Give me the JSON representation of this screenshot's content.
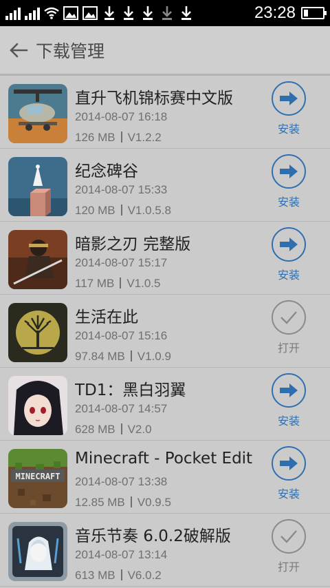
{
  "statusbar": {
    "time": "23:28"
  },
  "header": {
    "title": "下载管理"
  },
  "colors": {
    "accent": "#2f6fb0",
    "muted": "#8a8a8a"
  },
  "apps": [
    {
      "name": "直升飞机锦标赛中文版",
      "date": "2014-08-07 16:18",
      "size": "126 MB",
      "version": "V1.2.2",
      "action": "安装",
      "action_type": "install",
      "icon": "helicopter-icon"
    },
    {
      "name": "纪念碑谷",
      "date": "2014-08-07 15:33",
      "size": "120 MB",
      "version": "V1.0.5.8",
      "action": "安装",
      "action_type": "install",
      "icon": "monument-valley-icon"
    },
    {
      "name": "暗影之刃 完整版",
      "date": "2014-08-07 15:17",
      "size": "117 MB",
      "version": "V1.0.5",
      "action": "安装",
      "action_type": "install",
      "icon": "shadow-blade-icon"
    },
    {
      "name": "生活在此",
      "date": "2014-08-07 15:16",
      "size": "97.84 MB",
      "version": "V1.0.9",
      "action": "打开",
      "action_type": "open",
      "icon": "tree-icon"
    },
    {
      "name": "TD1：黑白羽翼",
      "date": "2014-08-07 14:57",
      "size": "628 MB",
      "version": "V2.0",
      "action": "安装",
      "action_type": "install",
      "icon": "anime-girl-icon"
    },
    {
      "name": "Minecraft - Pocket Edition",
      "date": "2014-08-07 13:38",
      "size": "12.85 MB",
      "version": "V0.9.5",
      "action": "安装",
      "action_type": "install",
      "icon": "minecraft-icon"
    },
    {
      "name": "音乐节奏 6.0.2破解版",
      "date": "2014-08-07 13:14",
      "size": "613 MB",
      "version": "V6.0.2",
      "action": "打开",
      "action_type": "open",
      "icon": "music-rhythm-icon"
    }
  ]
}
